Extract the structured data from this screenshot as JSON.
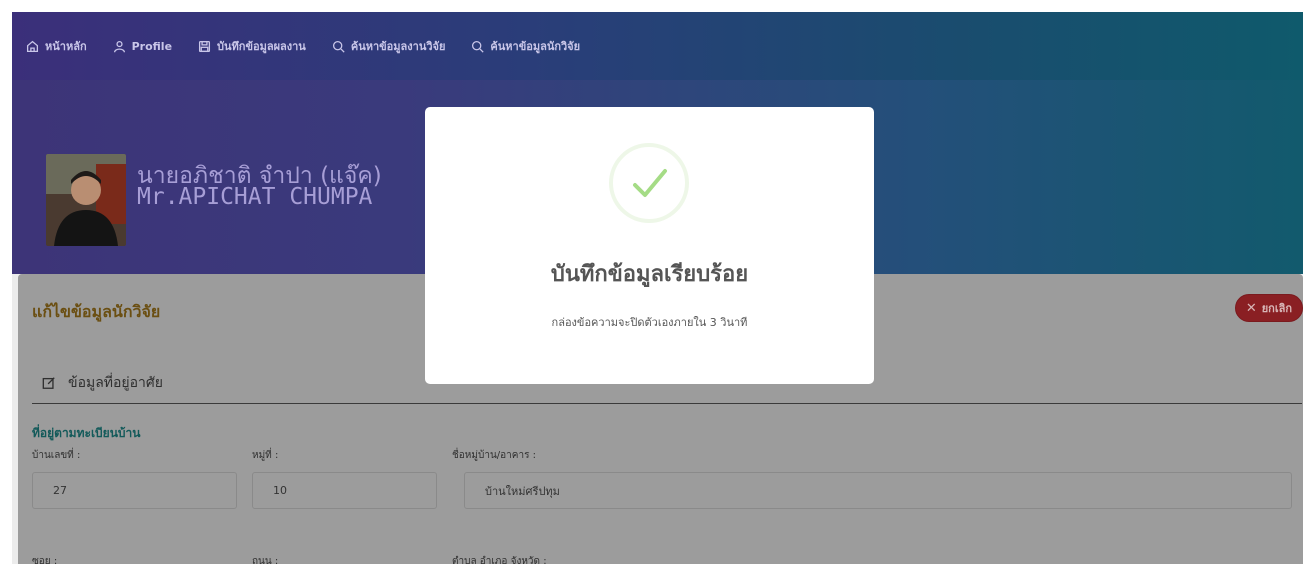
{
  "nav": {
    "items": [
      {
        "label": "หน้าหลัก",
        "icon": "home-icon"
      },
      {
        "label": "Profile",
        "icon": "user-icon"
      },
      {
        "label": "บันทึกข้อมูลผลงาน",
        "icon": "save-icon"
      },
      {
        "label": "ค้นหาข้อมูลงานวิจัย",
        "icon": "search-icon"
      },
      {
        "label": "ค้นหาข้อมูลนักวิจัย",
        "icon": "search-icon"
      }
    ]
  },
  "profile": {
    "name_th": "นายอภิชาติ จำปา (แจ๊ค)",
    "name_en": "Mr.APICHAT CHUMPA"
  },
  "form": {
    "title": "แก้ไขข้อมูลนักวิจัย",
    "cancel_label": "ยกเลิก",
    "section_title": "ข้อมูลที่อยู่อาศัย",
    "subsection_title": "ที่อยู่ตามทะเบียนบ้าน",
    "labels": {
      "house_no": "บ้านเลขที่ :",
      "moo": "หมู่ที่ :",
      "village": "ชื่อหมู่บ้าน/อาคาร :",
      "soi": "ซอย :",
      "road": "ถนน :",
      "district": "ตำบล อำเภอ จังหวัด :"
    },
    "values": {
      "house_no": "27",
      "moo": "10",
      "village": "บ้านใหม่ศรีปทุม"
    }
  },
  "modal": {
    "title": "บันทึกข้อมูลเรียบร้อย",
    "message": "กล่องข้อความจะปิดตัวเองภายใน 3 วินาที",
    "icon": "check-icon"
  },
  "colors": {
    "accent_title": "#d4a017",
    "cancel": "#e0474c",
    "success": "#a5dc86"
  }
}
